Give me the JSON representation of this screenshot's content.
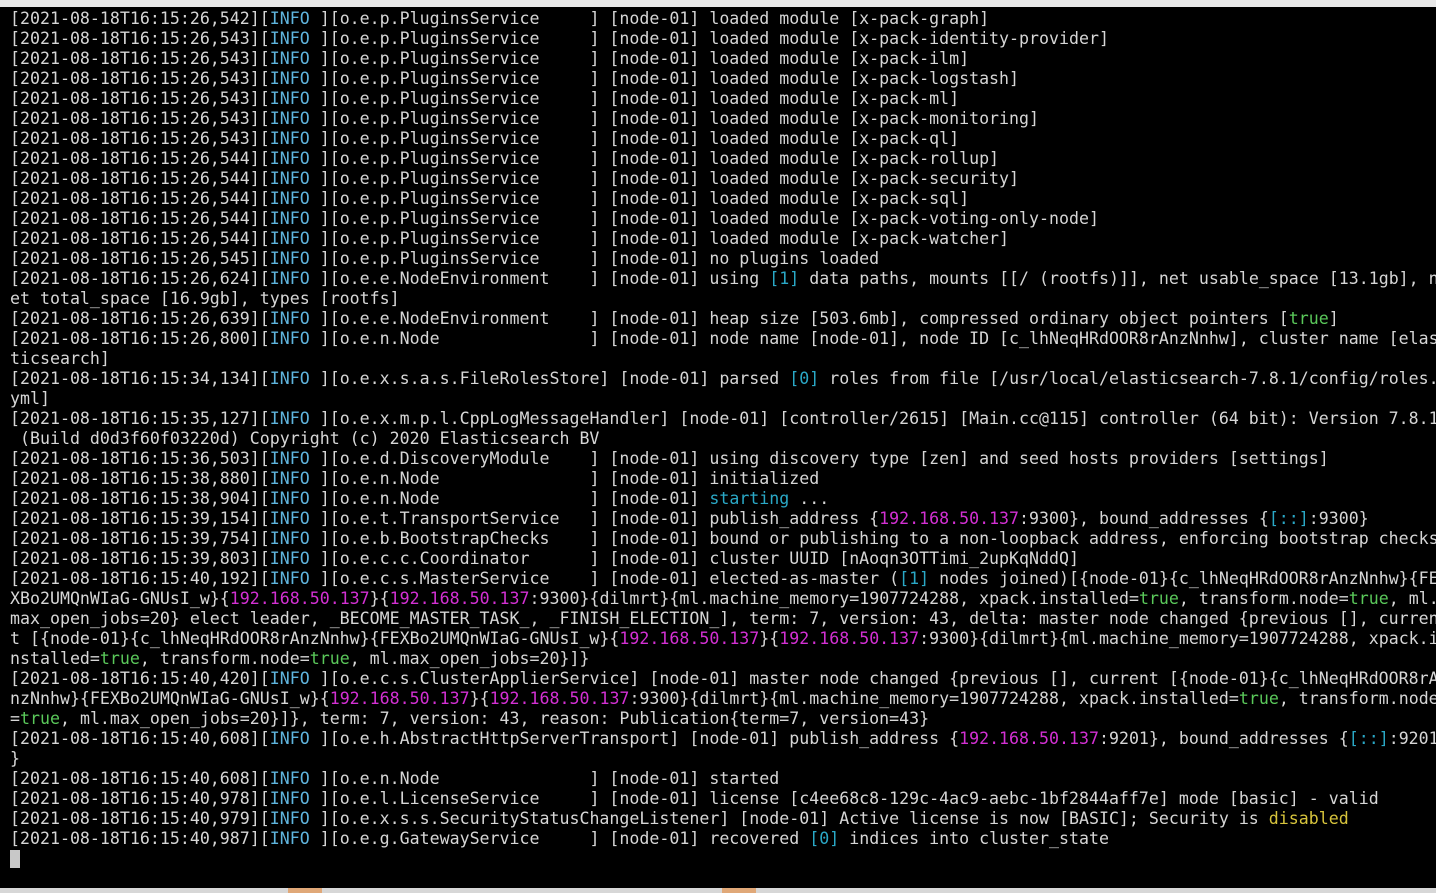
{
  "terminal": {
    "lines": [
      [
        {
          "t": "[2021-08-18T16:15:26,542]["
        },
        {
          "t": "INFO",
          "c": "info"
        },
        {
          "t": " ][o.e.p.PluginsService     ] [node-01] loaded module [x-pack-graph]"
        }
      ],
      [
        {
          "t": "[2021-08-18T16:15:26,543]["
        },
        {
          "t": "INFO",
          "c": "info"
        },
        {
          "t": " ][o.e.p.PluginsService     ] [node-01] loaded module [x-pack-identity-provider]"
        }
      ],
      [
        {
          "t": "[2021-08-18T16:15:26,543]["
        },
        {
          "t": "INFO",
          "c": "info"
        },
        {
          "t": " ][o.e.p.PluginsService     ] [node-01] loaded module [x-pack-ilm]"
        }
      ],
      [
        {
          "t": "[2021-08-18T16:15:26,543]["
        },
        {
          "t": "INFO",
          "c": "info"
        },
        {
          "t": " ][o.e.p.PluginsService     ] [node-01] loaded module [x-pack-logstash]"
        }
      ],
      [
        {
          "t": "[2021-08-18T16:15:26,543]["
        },
        {
          "t": "INFO",
          "c": "info"
        },
        {
          "t": " ][o.e.p.PluginsService     ] [node-01] loaded module [x-pack-ml]"
        }
      ],
      [
        {
          "t": "[2021-08-18T16:15:26,543]["
        },
        {
          "t": "INFO",
          "c": "info"
        },
        {
          "t": " ][o.e.p.PluginsService     ] [node-01] loaded module [x-pack-monitoring]"
        }
      ],
      [
        {
          "t": "[2021-08-18T16:15:26,543]["
        },
        {
          "t": "INFO",
          "c": "info"
        },
        {
          "t": " ][o.e.p.PluginsService     ] [node-01] loaded module [x-pack-ql]"
        }
      ],
      [
        {
          "t": "[2021-08-18T16:15:26,544]["
        },
        {
          "t": "INFO",
          "c": "info"
        },
        {
          "t": " ][o.e.p.PluginsService     ] [node-01] loaded module [x-pack-rollup]"
        }
      ],
      [
        {
          "t": "[2021-08-18T16:15:26,544]["
        },
        {
          "t": "INFO",
          "c": "info"
        },
        {
          "t": " ][o.e.p.PluginsService     ] [node-01] loaded module [x-pack-security]"
        }
      ],
      [
        {
          "t": "[2021-08-18T16:15:26,544]["
        },
        {
          "t": "INFO",
          "c": "info"
        },
        {
          "t": " ][o.e.p.PluginsService     ] [node-01] loaded module [x-pack-sql]"
        }
      ],
      [
        {
          "t": "[2021-08-18T16:15:26,544]["
        },
        {
          "t": "INFO",
          "c": "info"
        },
        {
          "t": " ][o.e.p.PluginsService     ] [node-01] loaded module [x-pack-voting-only-node]"
        }
      ],
      [
        {
          "t": "[2021-08-18T16:15:26,544]["
        },
        {
          "t": "INFO",
          "c": "info"
        },
        {
          "t": " ][o.e.p.PluginsService     ] [node-01] loaded module [x-pack-watcher]"
        }
      ],
      [
        {
          "t": "[2021-08-18T16:15:26,545]["
        },
        {
          "t": "INFO",
          "c": "info"
        },
        {
          "t": " ][o.e.p.PluginsService     ] [node-01] no plugins loaded"
        }
      ],
      [
        {
          "t": "[2021-08-18T16:15:26,624]["
        },
        {
          "t": "INFO",
          "c": "info"
        },
        {
          "t": " ][o.e.e.NodeEnvironment    ] [node-01] using "
        },
        {
          "t": "[1]",
          "c": "cyan"
        },
        {
          "t": " data paths, mounts [[/ (rootfs)]], net usable_space [13.1gb], n"
        }
      ],
      [
        {
          "t": "et total_space [16.9gb], types [rootfs]"
        }
      ],
      [
        {
          "t": "[2021-08-18T16:15:26,639]["
        },
        {
          "t": "INFO",
          "c": "info"
        },
        {
          "t": " ][o.e.e.NodeEnvironment    ] [node-01] heap size [503.6mb], compressed ordinary object pointers ["
        },
        {
          "t": "true",
          "c": "green"
        },
        {
          "t": "]"
        }
      ],
      [
        {
          "t": "[2021-08-18T16:15:26,800]["
        },
        {
          "t": "INFO",
          "c": "info"
        },
        {
          "t": " ][o.e.n.Node               ] [node-01] node name [node-01], node ID [c_lhNeqHRdOOR8rAnzNnhw], cluster name [elas"
        }
      ],
      [
        {
          "t": "ticsearch]"
        }
      ],
      [
        {
          "t": "[2021-08-18T16:15:34,134]["
        },
        {
          "t": "INFO",
          "c": "info"
        },
        {
          "t": " ][o.e.x.s.a.s.FileRolesStore] [node-01] parsed "
        },
        {
          "t": "[0]",
          "c": "cyan"
        },
        {
          "t": " roles from file [/usr/local/elasticsearch-7.8.1/config/roles."
        }
      ],
      [
        {
          "t": "yml]"
        }
      ],
      [
        {
          "t": "[2021-08-18T16:15:35,127]["
        },
        {
          "t": "INFO",
          "c": "info"
        },
        {
          "t": " ][o.e.x.m.p.l.CppLogMessageHandler] [node-01] [controller/2615] [Main.cc@115] controller (64 bit): Version 7.8.1"
        }
      ],
      [
        {
          "t": " (Build d0d3f60f03220d) Copyright (c) 2020 Elasticsearch BV"
        }
      ],
      [
        {
          "t": "[2021-08-18T16:15:36,503]["
        },
        {
          "t": "INFO",
          "c": "info"
        },
        {
          "t": " ][o.e.d.DiscoveryModule    ] [node-01] using discovery type [zen] and seed hosts providers [settings]"
        }
      ],
      [
        {
          "t": "[2021-08-18T16:15:38,880]["
        },
        {
          "t": "INFO",
          "c": "info"
        },
        {
          "t": " ][o.e.n.Node               ] [node-01] initialized"
        }
      ],
      [
        {
          "t": "[2021-08-18T16:15:38,904]["
        },
        {
          "t": "INFO",
          "c": "info"
        },
        {
          "t": " ][o.e.n.Node               ] [node-01] "
        },
        {
          "t": "starting",
          "c": "cyan"
        },
        {
          "t": " ..."
        }
      ],
      [
        {
          "t": "[2021-08-18T16:15:39,154]["
        },
        {
          "t": "INFO",
          "c": "info"
        },
        {
          "t": " ][o.e.t.TransportService   ] [node-01] publish_address {"
        },
        {
          "t": "192.168.50.137",
          "c": "mag"
        },
        {
          "t": ":9300}, bound_addresses {"
        },
        {
          "t": "[::]",
          "c": "cyan"
        },
        {
          "t": ":9300}"
        }
      ],
      [
        {
          "t": "[2021-08-18T16:15:39,754]["
        },
        {
          "t": "INFO",
          "c": "info"
        },
        {
          "t": " ][o.e.b.BootstrapChecks    ] [node-01] bound or publishing to a non-loopback address, enforcing bootstrap checks"
        }
      ],
      [
        {
          "t": "[2021-08-18T16:15:39,803]["
        },
        {
          "t": "INFO",
          "c": "info"
        },
        {
          "t": " ][o.e.c.c.Coordinator      ] [node-01] cluster UUID [nAoqn3OTTimi_2upKqNddQ]"
        }
      ],
      [
        {
          "t": "[2021-08-18T16:15:40,192]["
        },
        {
          "t": "INFO",
          "c": "info"
        },
        {
          "t": " ][o.e.c.s.MasterService    ] [node-01] elected-as-master ("
        },
        {
          "t": "[1]",
          "c": "cyan"
        },
        {
          "t": " nodes joined)[{node-01}{c_lhNeqHRdOOR8rAnzNnhw}{FE"
        }
      ],
      [
        {
          "t": "XBo2UMQnWIaG-GNUsI_w}{"
        },
        {
          "t": "192.168.50.137",
          "c": "mag"
        },
        {
          "t": "}{"
        },
        {
          "t": "192.168.50.137",
          "c": "mag"
        },
        {
          "t": ":9300}{dilmrt}{ml.machine_memory=1907724288, xpack.installed="
        },
        {
          "t": "true",
          "c": "green"
        },
        {
          "t": ", transform.node="
        },
        {
          "t": "true",
          "c": "green"
        },
        {
          "t": ", ml."
        }
      ],
      [
        {
          "t": "max_open_jobs=20} elect leader, _BECOME_MASTER_TASK_, _FINISH_ELECTION_], term: 7, version: 43, delta: master node changed {previous [], curren"
        }
      ],
      [
        {
          "t": "t [{node-01}{c_lhNeqHRdOOR8rAnzNnhw}{FEXBo2UMQnWIaG-GNUsI_w}{"
        },
        {
          "t": "192.168.50.137",
          "c": "mag"
        },
        {
          "t": "}{"
        },
        {
          "t": "192.168.50.137",
          "c": "mag"
        },
        {
          "t": ":9300}{dilmrt}{ml.machine_memory=1907724288, xpack.i"
        }
      ],
      [
        {
          "t": "nstalled="
        },
        {
          "t": "true",
          "c": "green"
        },
        {
          "t": ", transform.node="
        },
        {
          "t": "true",
          "c": "green"
        },
        {
          "t": ", ml.max_open_jobs=20}]}"
        }
      ],
      [
        {
          "t": "[2021-08-18T16:15:40,420]["
        },
        {
          "t": "INFO",
          "c": "info"
        },
        {
          "t": " ][o.e.c.s.ClusterApplierService] [node-01] master node changed {previous [], current [{node-01}{c_lhNeqHRdOOR8rA"
        }
      ],
      [
        {
          "t": "nzNnhw}{FEXBo2UMQnWIaG-GNUsI_w}{"
        },
        {
          "t": "192.168.50.137",
          "c": "mag"
        },
        {
          "t": "}{"
        },
        {
          "t": "192.168.50.137",
          "c": "mag"
        },
        {
          "t": ":9300}{dilmrt}{ml.machine_memory=1907724288, xpack.installed="
        },
        {
          "t": "true",
          "c": "green"
        },
        {
          "t": ", transform.node"
        }
      ],
      [
        {
          "t": "="
        },
        {
          "t": "true",
          "c": "green"
        },
        {
          "t": ", ml.max_open_jobs=20}]}, term: 7, version: 43, reason: Publication{term=7, version=43}"
        }
      ],
      [
        {
          "t": "[2021-08-18T16:15:40,608]["
        },
        {
          "t": "INFO",
          "c": "info"
        },
        {
          "t": " ][o.e.h.AbstractHttpServerTransport] [node-01] publish_address {"
        },
        {
          "t": "192.168.50.137",
          "c": "mag"
        },
        {
          "t": ":9201}, bound_addresses {"
        },
        {
          "t": "[::]",
          "c": "cyan"
        },
        {
          "t": ":9201"
        }
      ],
      [
        {
          "t": "}"
        }
      ],
      [
        {
          "t": "[2021-08-18T16:15:40,608]["
        },
        {
          "t": "INFO",
          "c": "info"
        },
        {
          "t": " ][o.e.n.Node               ] [node-01] started"
        }
      ],
      [
        {
          "t": "[2021-08-18T16:15:40,978]["
        },
        {
          "t": "INFO",
          "c": "info"
        },
        {
          "t": " ][o.e.l.LicenseService     ] [node-01] license [c4ee68c8-129c-4ac9-aebc-1bf2844aff7e] mode [basic] - valid"
        }
      ],
      [
        {
          "t": "[2021-08-18T16:15:40,979]["
        },
        {
          "t": "INFO",
          "c": "info"
        },
        {
          "t": " ][o.e.x.s.s.SecurityStatusChangeListener] [node-01] Active license is now [BASIC]; Security is "
        },
        {
          "t": "disabled",
          "c": "yellow"
        }
      ],
      [
        {
          "t": "[2021-08-18T16:15:40,987]["
        },
        {
          "t": "INFO",
          "c": "info"
        },
        {
          "t": " ][o.e.g.GatewayService     ] [node-01] recovered "
        },
        {
          "t": "[0]",
          "c": "cyan"
        },
        {
          "t": " indices into cluster_state"
        }
      ]
    ]
  }
}
